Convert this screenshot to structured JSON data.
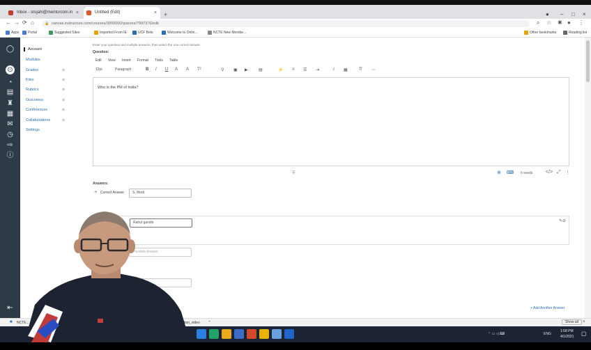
{
  "browser": {
    "tabs": [
      {
        "label": "Inbox - srujahi@mentorcom.in",
        "favicon_color": "#c23b2b"
      },
      {
        "label": "Untitled (Edit)",
        "favicon_color": "#e1532d"
      }
    ],
    "new_tab": "+",
    "address": "canvas.instructure.com/courses/3000000/quizzes/7997376/edit",
    "bookmarks": [
      {
        "label": "Apps",
        "color": "#4a7bd1"
      },
      {
        "label": "Portal",
        "color": "#4a7bd1"
      },
      {
        "label": "Suggested Sites",
        "color": "#3c9a5c"
      },
      {
        "label": "Imported From IE",
        "color": "#e6a400"
      },
      {
        "label": "UCF Bets",
        "color": "#2d6fb3"
      },
      {
        "label": "Welcome to Onlin...",
        "color": "#2d6fb3"
      },
      {
        "label": "NCTE New Membe...",
        "color": "#888888"
      }
    ],
    "other_bookmarks": "Other bookmarks",
    "reading_list": "Reading list"
  },
  "course_nav": {
    "items": [
      {
        "label": "Account",
        "active": true
      },
      {
        "label": "Modules",
        "active": false
      },
      {
        "label": "Grades",
        "active": false
      },
      {
        "label": "Files",
        "active": false
      },
      {
        "label": "Rubrics",
        "active": false
      },
      {
        "label": "Outcomes",
        "active": false
      },
      {
        "label": "Conferences",
        "active": false
      },
      {
        "label": "Collaborations",
        "active": false
      },
      {
        "label": "Settings",
        "active": false
      }
    ]
  },
  "editor": {
    "hint": "Enter your question and multiple answers, then select the one correct answer.",
    "section_label": "Question:",
    "menu": [
      "Edit",
      "View",
      "Insert",
      "Format",
      "Tools",
      "Table"
    ],
    "font_size": "12pt",
    "block_format": "Paragraph",
    "question_text": "Who is the PM of India?",
    "word_count": "6 words"
  },
  "answers": {
    "section_label": "Answers:",
    "correct_label": "Correct Answer",
    "answer1": "S. Modi",
    "answer2": "Rahul gandhi",
    "answer3_placeholder": "Possible Answer",
    "add_answer": "+ Add Another Answer"
  },
  "taskbar": {
    "download_file": "NCTE...",
    "download2": "tion_video",
    "show_all": "Show all",
    "time": "1:58 PM",
    "date": "4/1/2021",
    "lang": "ENG"
  },
  "colors": {
    "rail": "#2f3a47",
    "link": "#2d6fb3",
    "os_taskbar": "#1c2433"
  }
}
